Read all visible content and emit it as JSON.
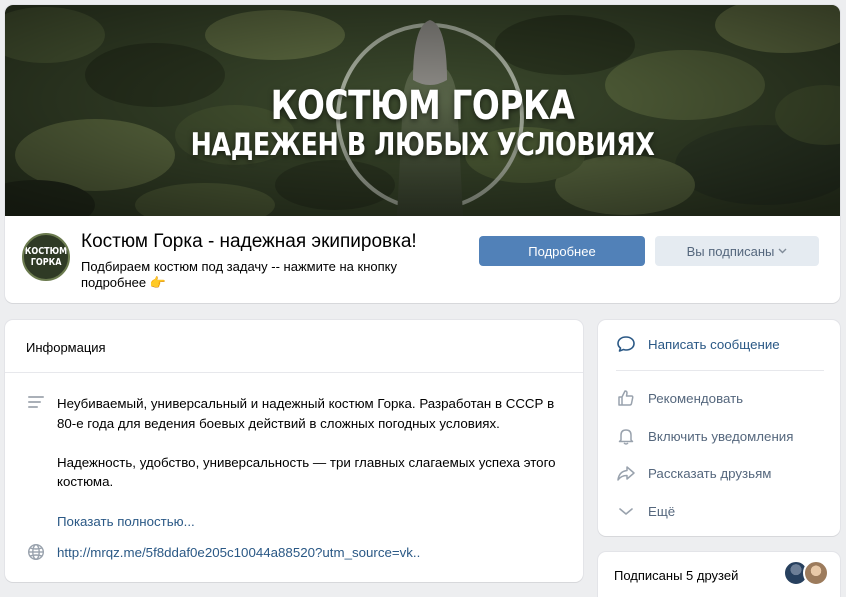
{
  "cover": {
    "line1": "КОСТЮМ ГОРКА",
    "line2": "НАДЕЖЕН В ЛЮБЫХ УСЛОВИЯХ"
  },
  "group": {
    "avatar_line1": "КОСТЮМ",
    "avatar_line2": "ГОРКА",
    "name": "Костюм Горка - надежная экипировка!",
    "status": "Подбираем костюм под задачу -- нажмите на кнопку подробнее",
    "status_emoji": "👉",
    "more_button": "Подробнее",
    "subscribed_button": "Вы подписаны",
    "subscribed_icon": "chevron-down-icon"
  },
  "info": {
    "title": "Информация",
    "description_p1": "Неубиваемый, универсальный и надежный костюм Горка. Разработан в СССР в 80-е года для ведения боевых действий в сложных погодных условиях.",
    "description_p2": "Надежность, удобство, универсальность — три главных слагаемых успеха этого костюма.",
    "show_full": "Показать полностью...",
    "link": "http://mrqz.me/5f8ddaf0e205c10044a88520?utm_source=vk.."
  },
  "actions": {
    "message": "Написать сообщение",
    "recommend": "Рекомендовать",
    "notify": "Включить уведомления",
    "share": "Рассказать друзьям",
    "more": "Ещё"
  },
  "friends": {
    "label": "Подписаны 5 друзей"
  },
  "colors": {
    "accent_button": "#5181b8",
    "link": "#2a5885",
    "secondary_button": "#e5ebf1",
    "background": "#edeef0"
  }
}
